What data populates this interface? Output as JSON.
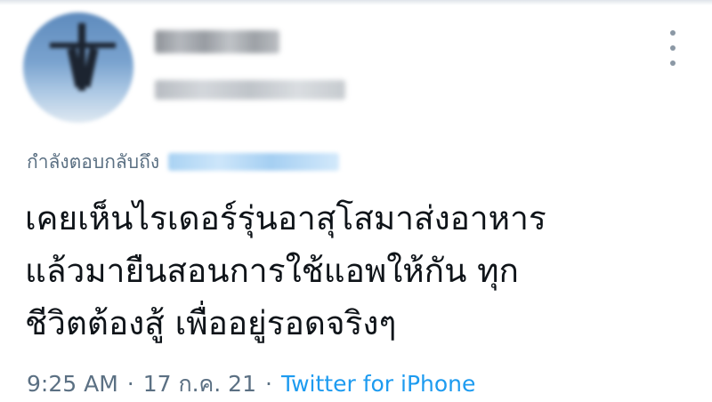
{
  "tweet": {
    "author": {
      "avatar_icon": "profile-avatar-blurred"
    },
    "more_icon": "more-vertical-icon",
    "reply_prefix": "กำลังตอบกลับถึง",
    "text_lines": [
      "เคยเห็นไรเดอร์รุ่นอาสุโสมาส่งอาหาร",
      "แล้วมายืนสอนการใช้แอพให้กัน  ทุก",
      "ชีวิตต้องสู้ เพื่ออยู่รอดจริงๆ"
    ],
    "time": "9:25 AM",
    "separator": "·",
    "date": "17 ก.ค. 21",
    "source": "Twitter for iPhone",
    "colors": {
      "link": "#1d9bf0",
      "muted": "#5b7083",
      "text": "#0f1419"
    }
  }
}
